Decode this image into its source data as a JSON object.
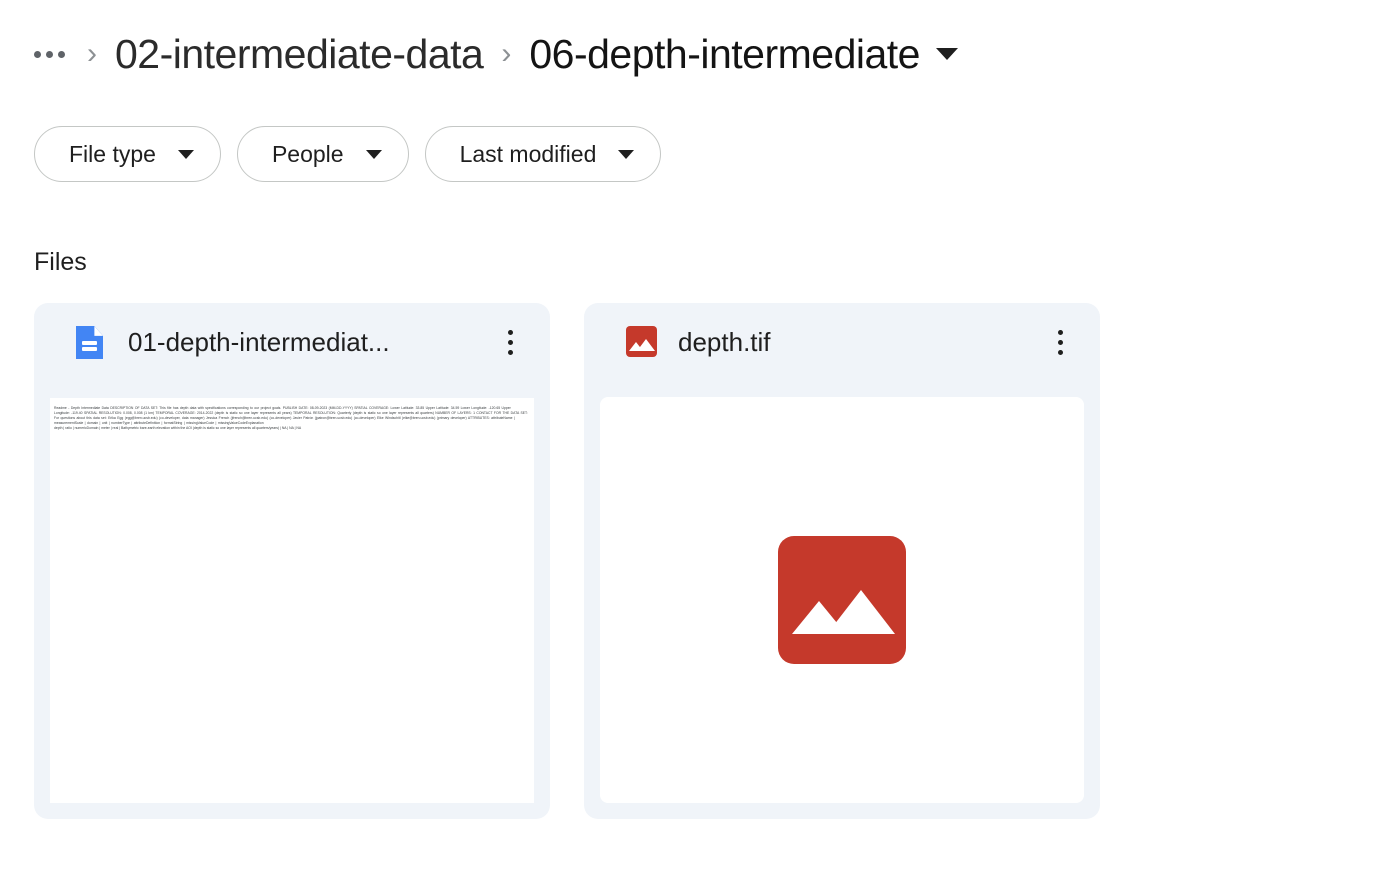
{
  "breadcrumb": {
    "overflow_label": "...",
    "separator": "›",
    "items": [
      {
        "label": "02-intermediate-data"
      },
      {
        "label": "06-depth-intermediate"
      }
    ],
    "caret_icon": "chevron-down-icon"
  },
  "filters": [
    {
      "label": "File type",
      "caret_icon": "chevron-down-icon"
    },
    {
      "label": "People",
      "caret_icon": "chevron-down-icon"
    },
    {
      "label": "Last modified",
      "caret_icon": "chevron-down-icon"
    }
  ],
  "section": {
    "title": "Files"
  },
  "files": [
    {
      "name": "01-depth-intermediat...",
      "icon": "google-docs-icon",
      "menu_icon": "more-vert-icon",
      "preview_type": "document-text",
      "preview_text": "Readme - Depth Intermediate Data DESCRIPTION OF DATA SET: This file has depth data with specifications corresponding to our project goals. PUBLISH DATE: 08-09-2023 (MM-DD-YYYY) SPATIAL COVERAGE: Lower Latitude: 33.85 Upper Latitude: 34.59 Lower Longitude: -120.65 Upper Longitude: -119.40 SPATIAL RESOLUTION: 0.008, 0.008 (1 km) TEMPORAL COVERAGE: 2014-2022 (depth is static so one layer represents all years) TEMPORAL RESOLUTION: Quarterly (depth is static so one layer represents all quarters) NUMBER OF LAYERS: 1 CONTACT FOR THE DATA SET: For questions about this data set: Erika Egg (egg@bren.ucsb.edu) (co-developer, data manager) Jessica French (jfrench@bren.ucsb.edu) (co-developer) Javier Patrón (jpatron@bren.ucsb.edu) (co-developer) Elke Windschitl (elke@bren.ucsb.edu) (primary developer) ATTRIBUTES: attributeName | measurementScale | domain | unit | numberType | attributeDefinition | formatString | missingValueCode | missingValueCodeExplanation",
      "preview_text_tail": "depth | ratio | numericDomain | meter | real | Bathymetric bare-earth elevation within the AOI (depth is static so one layer represents all quarters/years) | NA | NA | NA"
    },
    {
      "name": "depth.tif",
      "icon": "image-file-icon",
      "menu_icon": "more-vert-icon",
      "preview_type": "image-placeholder",
      "thumbnail_icon": "image-placeholder-icon"
    }
  ],
  "colors": {
    "card_background": "#f0f4f9",
    "docs_blue": "#4285f4",
    "image_red": "#c5392b",
    "text_primary": "#1f1f1f",
    "chip_border": "#c4c7c5"
  }
}
